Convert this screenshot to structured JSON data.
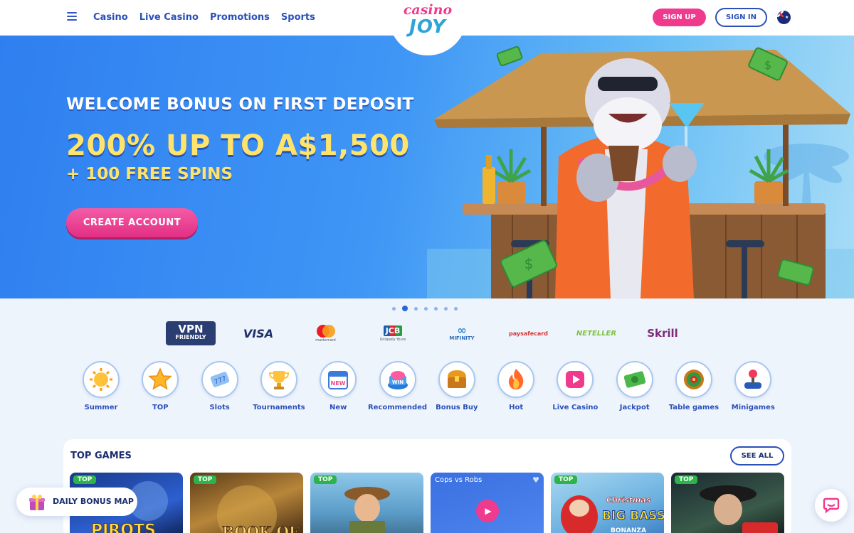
{
  "header": {
    "nav": [
      "Casino",
      "Live Casino",
      "Promotions",
      "Sports"
    ],
    "logo_top": "casino",
    "logo_bottom": "JOY",
    "signup_label": "SIGN UP",
    "signin_label": "SIGN IN",
    "flag_icon": "australia-flag-icon"
  },
  "hero": {
    "subtitle": "WELCOME BONUS ON FIRST DEPOSIT",
    "amount": "200% UP TO A$1,500",
    "spins": "+ 100 FREE SPINS",
    "cta_label": "CREATE ACCOUNT",
    "slide_count": 7,
    "active_slide": 2
  },
  "payments": {
    "vpn_line1": "VPN",
    "vpn_line2": "FRIENDLY",
    "visa": "VISA",
    "mastercard": "mastercard",
    "jcb": "JCB",
    "jcb_tag": "Uniquely Yours",
    "mifinity": "MIFINITY",
    "paysafe": "paysafecard",
    "neteller": "NETELLER",
    "skrill": "Skrill"
  },
  "categories": [
    {
      "label": "Summer",
      "icon": "sun-icon"
    },
    {
      "label": "TOP",
      "icon": "star-icon"
    },
    {
      "label": "Slots",
      "icon": "ticket-icon"
    },
    {
      "label": "Tournaments",
      "icon": "trophy-icon"
    },
    {
      "label": "New",
      "icon": "new-calendar-icon"
    },
    {
      "label": "Recommended",
      "icon": "win-button-icon"
    },
    {
      "label": "Bonus Buy",
      "icon": "treasure-chest-icon"
    },
    {
      "label": "Hot",
      "icon": "flame-icon"
    },
    {
      "label": "Live Casino",
      "icon": "play-icon"
    },
    {
      "label": "Jackpot",
      "icon": "cash-icon"
    },
    {
      "label": "Table games",
      "icon": "roulette-icon"
    },
    {
      "label": "Minigames",
      "icon": "joystick-icon"
    }
  ],
  "top_games": {
    "title": "TOP GAMES",
    "see_all_label": "SEE ALL",
    "top_tag": "TOP",
    "cops_title": "Cops vs Robs",
    "game_texts": [
      "PIROTS",
      "BOOK OF",
      "Christmas",
      "BIG BASS",
      "BONANZA"
    ]
  },
  "daily_bonus_label": "DAILY BONUS MAP",
  "colors": {
    "brand_pink": "#ef3a8e",
    "brand_blue": "#2a50b8",
    "hero_yellow": "#ffe36a"
  }
}
